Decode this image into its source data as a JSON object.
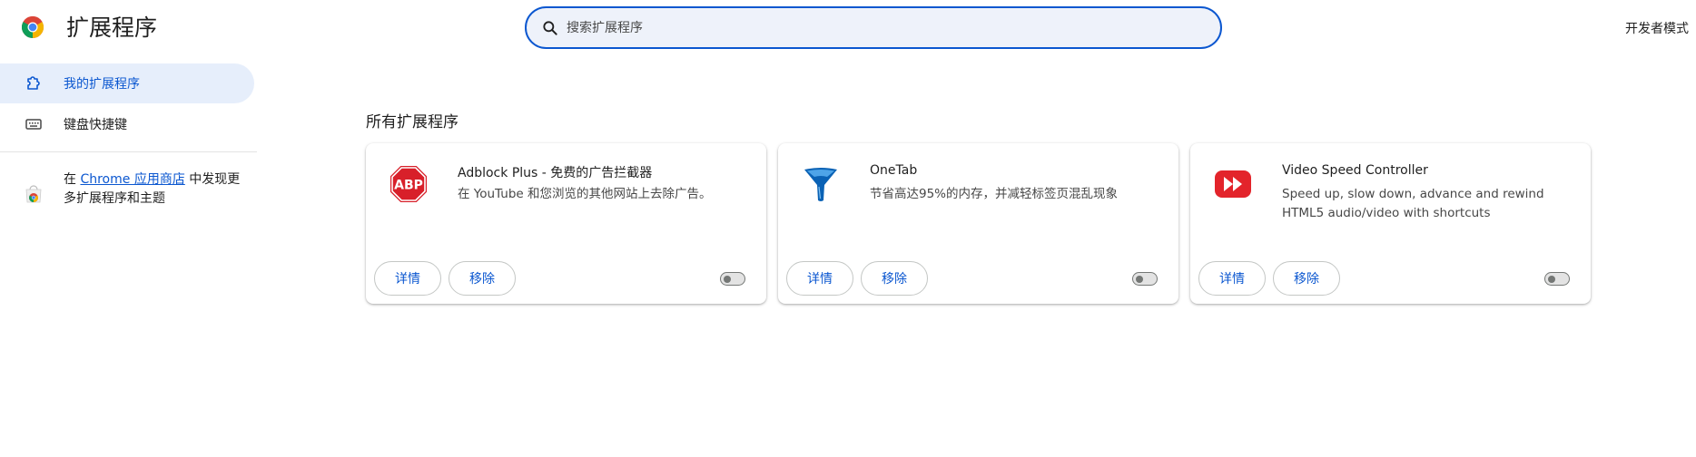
{
  "header": {
    "title": "扩展程序",
    "dev_mode_label": "开发者模式"
  },
  "search": {
    "placeholder": "搜索扩展程序",
    "value": ""
  },
  "sidebar": {
    "items": [
      {
        "label": "我的扩展程序",
        "icon": "extension-icon",
        "active": true
      },
      {
        "label": "键盘快捷键",
        "icon": "keyboard-icon",
        "active": false
      }
    ],
    "store_promo": {
      "prefix": "在 ",
      "link_text": "Chrome 应用商店",
      "suffix": " 中发现更多扩展程序和主题"
    }
  },
  "main": {
    "section_title": "所有扩展程序",
    "extensions": [
      {
        "name": "Adblock Plus - 免费的广告拦截器",
        "description": "在 YouTube 和您浏览的其他网站上去除广告。",
        "icon": "abp-icon",
        "details_label": "详情",
        "remove_label": "移除",
        "enabled": false
      },
      {
        "name": "OneTab",
        "description": "节省高达95%的内存，并减轻标签页混乱现象",
        "icon": "onetab-funnel-icon",
        "details_label": "详情",
        "remove_label": "移除",
        "enabled": false
      },
      {
        "name": "Video Speed Controller",
        "description": "Speed up, slow down, advance and rewind HTML5 audio/video with shortcuts",
        "icon": "fast-forward-icon",
        "details_label": "详情",
        "remove_label": "移除",
        "enabled": false
      }
    ]
  },
  "colors": {
    "accent": "#0b57d0",
    "search_bg": "#eef2fa",
    "active_item_bg": "#e6eefb",
    "abp_red": "#d8202a",
    "onetab_blue": "#0a62b5",
    "vsc_red": "#e3242b"
  }
}
